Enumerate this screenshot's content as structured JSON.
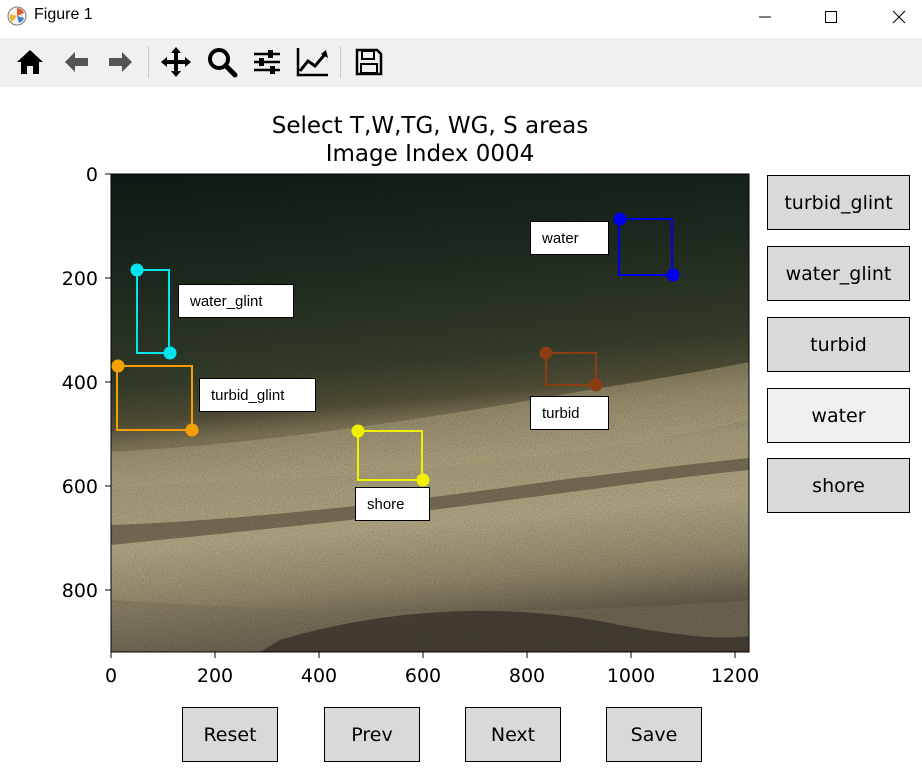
{
  "window": {
    "title": "Figure 1"
  },
  "toolbar": {
    "buttons": [
      {
        "icon": "home-icon"
      },
      {
        "icon": "back-arrow-icon"
      },
      {
        "icon": "forward-arrow-icon"
      },
      {
        "icon": "pan-move-icon"
      },
      {
        "icon": "zoom-magnifier-icon"
      },
      {
        "icon": "subplots-sliders-icon"
      },
      {
        "icon": "edit-axes-chart-icon"
      },
      {
        "icon": "save-floppy-icon"
      }
    ]
  },
  "plot": {
    "title_line1": "Select T,W,TG, WG, S areas",
    "title_line2": "Image Index 0004",
    "x_ticks": [
      "0",
      "200",
      "400",
      "600",
      "800",
      "1000",
      "1200"
    ],
    "y_ticks": [
      "0",
      "200",
      "400",
      "600",
      "800"
    ],
    "region_labels": {
      "water": "water",
      "water_glint": "water_glint",
      "turbid_glint": "turbid_glint",
      "turbid": "turbid",
      "shore": "shore"
    },
    "colors": {
      "water": "#0000ee",
      "water_glint": "#00e5ee",
      "turbid_glint": "#f5a000",
      "turbid": "#8b3c10",
      "shore": "#f0f000"
    }
  },
  "side_buttons": {
    "turbid_glint": "turbid_glint",
    "water_glint": "water_glint",
    "turbid": "turbid",
    "water": "water",
    "shore": "shore"
  },
  "bottom_buttons": {
    "reset": "Reset",
    "prev": "Prev",
    "next": "Next",
    "save": "Save"
  }
}
